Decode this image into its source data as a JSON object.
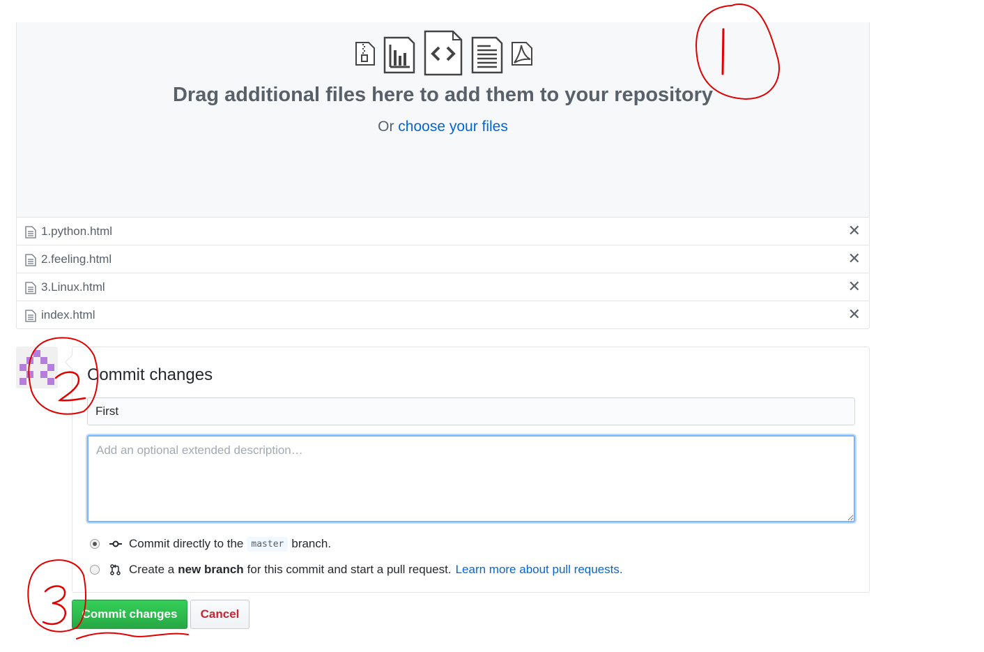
{
  "dropzone": {
    "title": "Drag additional files here to add them to your repository",
    "prefix": "Or",
    "choose_link": "choose your files",
    "file_type_icons": [
      "zip-file-icon",
      "graph-file-icon",
      "code-file-icon",
      "text-file-icon",
      "pdf-file-icon"
    ]
  },
  "files": [
    {
      "name": "1.python.html",
      "remove": "✕"
    },
    {
      "name": "2.feeling.html",
      "remove": "✕"
    },
    {
      "name": "3.Linux.html",
      "remove": "✕"
    },
    {
      "name": "index.html",
      "remove": "✕"
    }
  ],
  "commit": {
    "heading": "Commit changes",
    "summary_value": "First",
    "description_placeholder": "Add an optional extended description…",
    "option_direct": {
      "text_before": "Commit directly to the",
      "branch": "master",
      "text_after": "branch."
    },
    "option_new_branch": {
      "text_before": "Create a",
      "bold": "new branch",
      "text_after": "for this commit and start a pull request.",
      "link": "Learn more about pull requests."
    },
    "selected_option": "direct"
  },
  "buttons": {
    "commit": "Commit changes",
    "cancel": "Cancel"
  },
  "annotations": [
    "1",
    "2",
    "3"
  ],
  "colors": {
    "link": "#0366d6",
    "commit_button": "#28a745",
    "cancel_text": "#cb2431",
    "annotation": "#e00000",
    "avatar": "#b57edc"
  }
}
